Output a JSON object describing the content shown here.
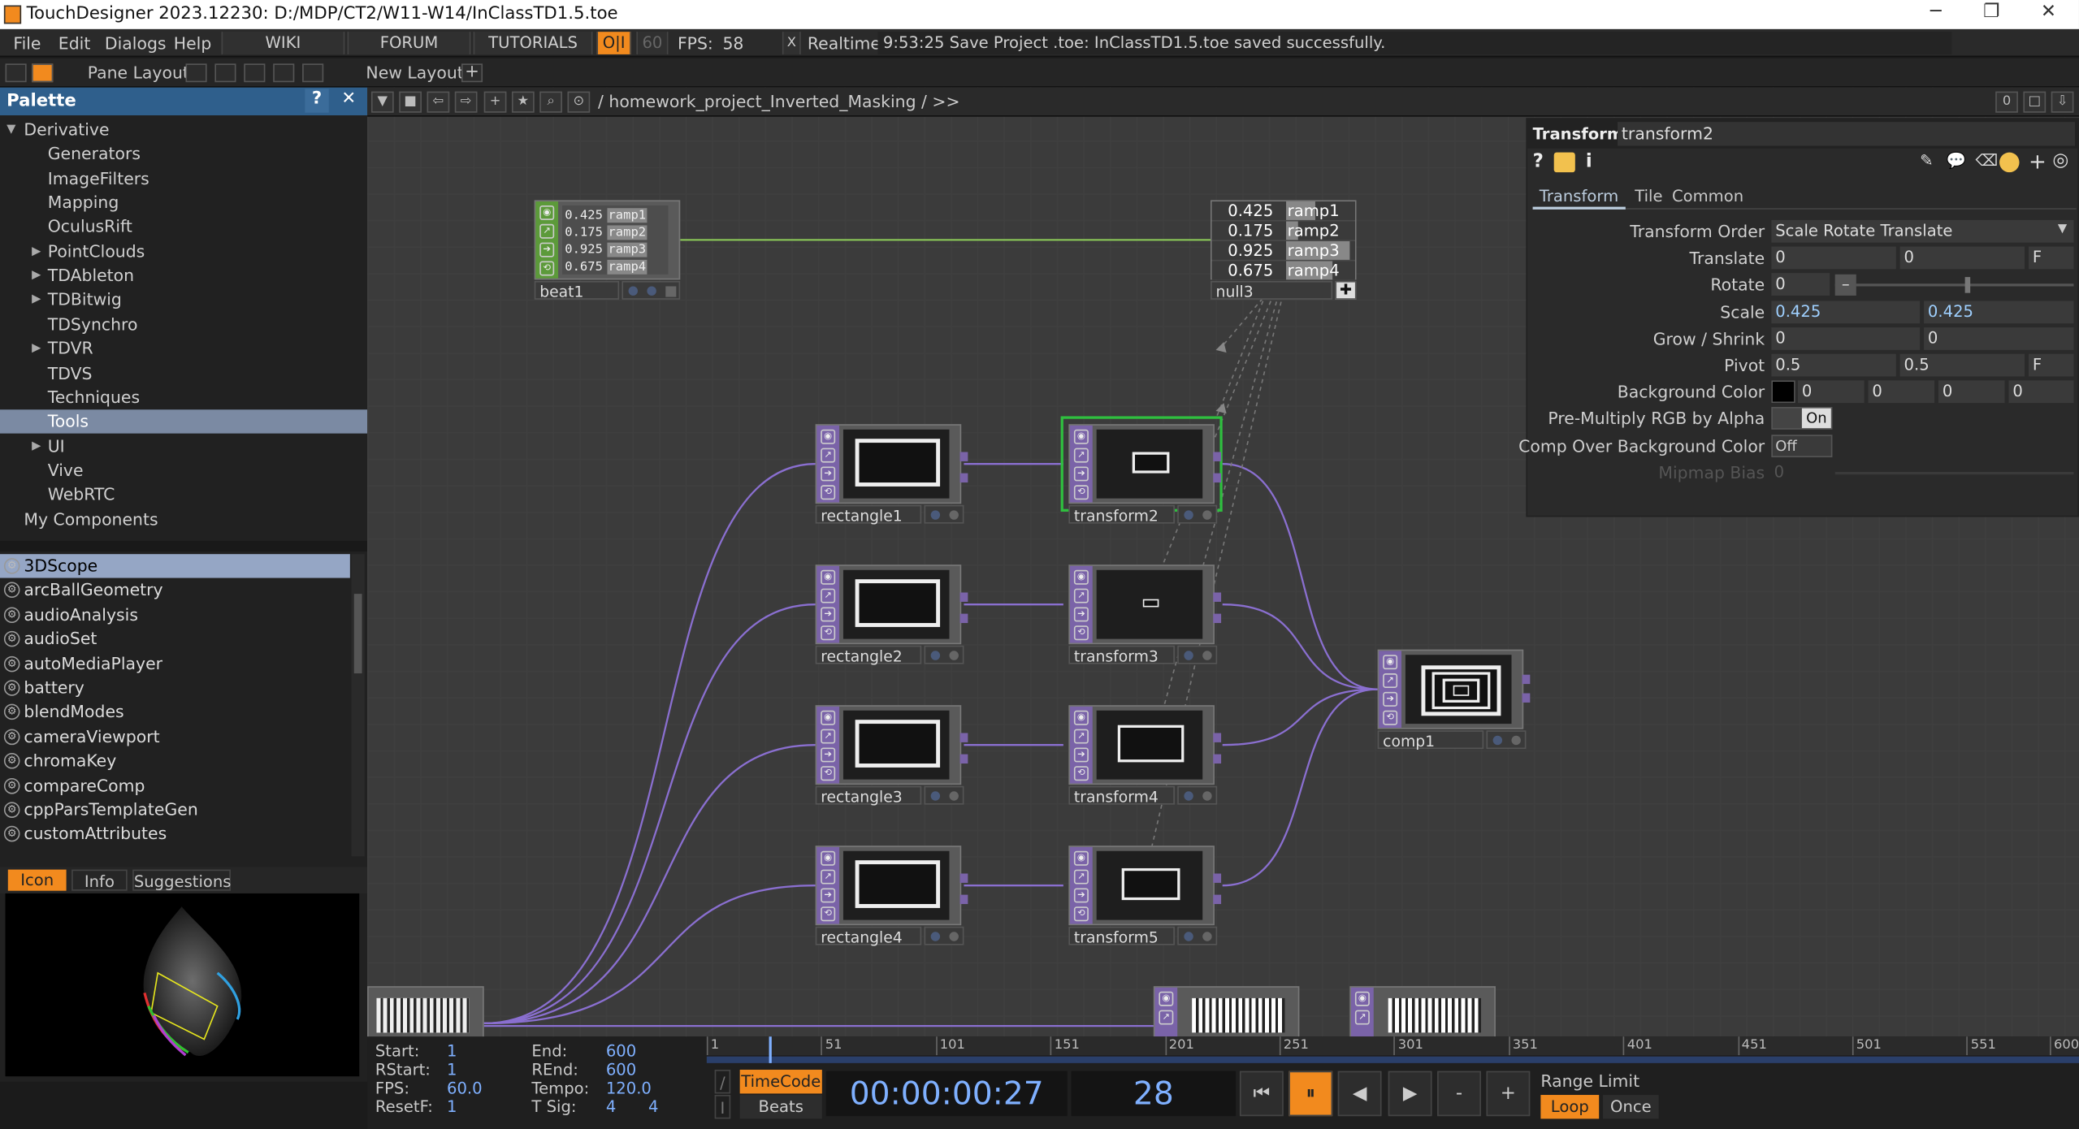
{
  "window": {
    "title": "TouchDesigner 2023.12230: D:/MDP/CT2/W11-W14/InClassTD1.5.toe",
    "minimize": "─",
    "restore": "❐",
    "close": "✕"
  },
  "menu": {
    "items": [
      "File",
      "Edit",
      "Dialogs",
      "Help"
    ],
    "wiki": "WIKI",
    "forum": "FORUM",
    "tutorials": "TUTORIALS",
    "oi": "O|I",
    "fps_cap": "60",
    "fps_label": "FPS:",
    "fps_value": "58",
    "realtime_check": "X",
    "realtime": "Realtime",
    "status": "9:53:25 Save Project .toe: InClassTD1.5.toe saved successfully."
  },
  "pane": {
    "pane_layout": "Pane Layout",
    "new_layout": "New Layout",
    "add": "+"
  },
  "palette": {
    "title": "Palette",
    "help": "?",
    "close": "✕",
    "tree": [
      {
        "label": "Derivative",
        "level": 0,
        "expanded": true
      },
      {
        "label": "Generators",
        "level": 1
      },
      {
        "label": "ImageFilters",
        "level": 1
      },
      {
        "label": "Mapping",
        "level": 1
      },
      {
        "label": "OculusRift",
        "level": 1
      },
      {
        "label": "PointClouds",
        "level": 1,
        "collapsed": true
      },
      {
        "label": "TDAbleton",
        "level": 1,
        "collapsed": true
      },
      {
        "label": "TDBitwig",
        "level": 1,
        "collapsed": true
      },
      {
        "label": "TDSynchro",
        "level": 1
      },
      {
        "label": "TDVR",
        "level": 1,
        "collapsed": true
      },
      {
        "label": "TDVS",
        "level": 1
      },
      {
        "label": "Techniques",
        "level": 1
      },
      {
        "label": "Tools",
        "level": 1,
        "selected": true
      },
      {
        "label": "UI",
        "level": 1,
        "collapsed": true
      },
      {
        "label": "Vive",
        "level": 1
      },
      {
        "label": "WebRTC",
        "level": 1
      },
      {
        "label": "My Components",
        "level": 0
      }
    ],
    "components": [
      "3DScope",
      "arcBallGeometry",
      "audioAnalysis",
      "audioSet",
      "autoMediaPlayer",
      "battery",
      "blendModes",
      "cameraViewport",
      "chromaKey",
      "compareComp",
      "cppParsTemplateGen",
      "customAttributes"
    ],
    "selected_component": "3DScope",
    "tabs": {
      "icon": "Icon",
      "info": "Info",
      "suggestions": "Suggestions"
    }
  },
  "network": {
    "path": "/ homework_project_Inverted_Masking / >>",
    "counter": "0"
  },
  "nodes": {
    "beat1": {
      "name": "beat1",
      "channels": [
        {
          "value": "0.425",
          "name": "ramp1"
        },
        {
          "value": "0.175",
          "name": "ramp2"
        },
        {
          "value": "0.925",
          "name": "ramp3"
        },
        {
          "value": "0.675",
          "name": "ramp4"
        }
      ]
    },
    "null3": {
      "name": "null3",
      "channels": [
        {
          "value": "0.425",
          "name": "ramp1",
          "fill": 0.425
        },
        {
          "value": "0.175",
          "name": "ramp2",
          "fill": 0.175
        },
        {
          "value": "0.925",
          "name": "ramp3",
          "fill": 0.925
        },
        {
          "value": "0.675",
          "name": "ramp4",
          "fill": 0.675
        }
      ]
    },
    "rectangles": [
      "rectangle1",
      "rectangle2",
      "rectangle3",
      "rectangle4"
    ],
    "transforms": [
      "transform2",
      "transform3",
      "transform4",
      "transform5"
    ],
    "comp": "comp1"
  },
  "params": {
    "op_type": "Transform",
    "op_name": "transform2",
    "tabs": [
      "Transform",
      "Tile",
      "Common"
    ],
    "transform_order_label": "Transform Order",
    "transform_order": "Scale Rotate Translate",
    "translate_label": "Translate",
    "translate": [
      "0",
      "0"
    ],
    "translate_unit": "F",
    "rotate_label": "Rotate",
    "rotate": "0",
    "scale_label": "Scale",
    "scale": [
      "0.425",
      "0.425"
    ],
    "grow_label": "Grow / Shrink",
    "grow": [
      "0",
      "0"
    ],
    "pivot_label": "Pivot",
    "pivot": [
      "0.5",
      "0.5"
    ],
    "pivot_unit": "F",
    "bg_color_label": "Background Color",
    "bg_color": [
      "0",
      "0",
      "0",
      "0"
    ],
    "premult_label": "Pre-Multiply RGB by Alpha",
    "premult": "On",
    "comp_over_label": "Comp Over Background Color",
    "comp_over": "Off",
    "mipmap_label": "Mipmap Bias",
    "mipmap": "0"
  },
  "timeline": {
    "ticks": [
      "1",
      "51",
      "101",
      "151",
      "201",
      "251",
      "301",
      "351",
      "401",
      "451",
      "501",
      "551",
      "600"
    ],
    "start_label": "Start:",
    "start": "1",
    "rstart_label": "RStart:",
    "rstart": "1",
    "fps_label": "FPS:",
    "fps": "60.0",
    "resetf_label": "ResetF:",
    "resetf": "1",
    "end_label": "End:",
    "end": "600",
    "rend_label": "REnd:",
    "rend": "600",
    "tempo_label": "Tempo:",
    "tempo": "120.0",
    "tsig_label": "T Sig:",
    "tsig_a": "4",
    "tsig_b": "4",
    "timecode_btn": "TimeCode",
    "beats_btn": "Beats",
    "timecode": "00:00:00:27",
    "frame": "28",
    "range_limit": "Range Limit",
    "loop": "Loop",
    "once": "Once",
    "playhead_frame": 28
  },
  "colors": {
    "accent_orange": "#f28a1e",
    "selection_blue": "#2f5f8c",
    "top_node": "#7a63a8",
    "chop_node": "#5c9a3a",
    "wire_purple": "#8a6fd0",
    "wire_green": "#8fd05a"
  }
}
